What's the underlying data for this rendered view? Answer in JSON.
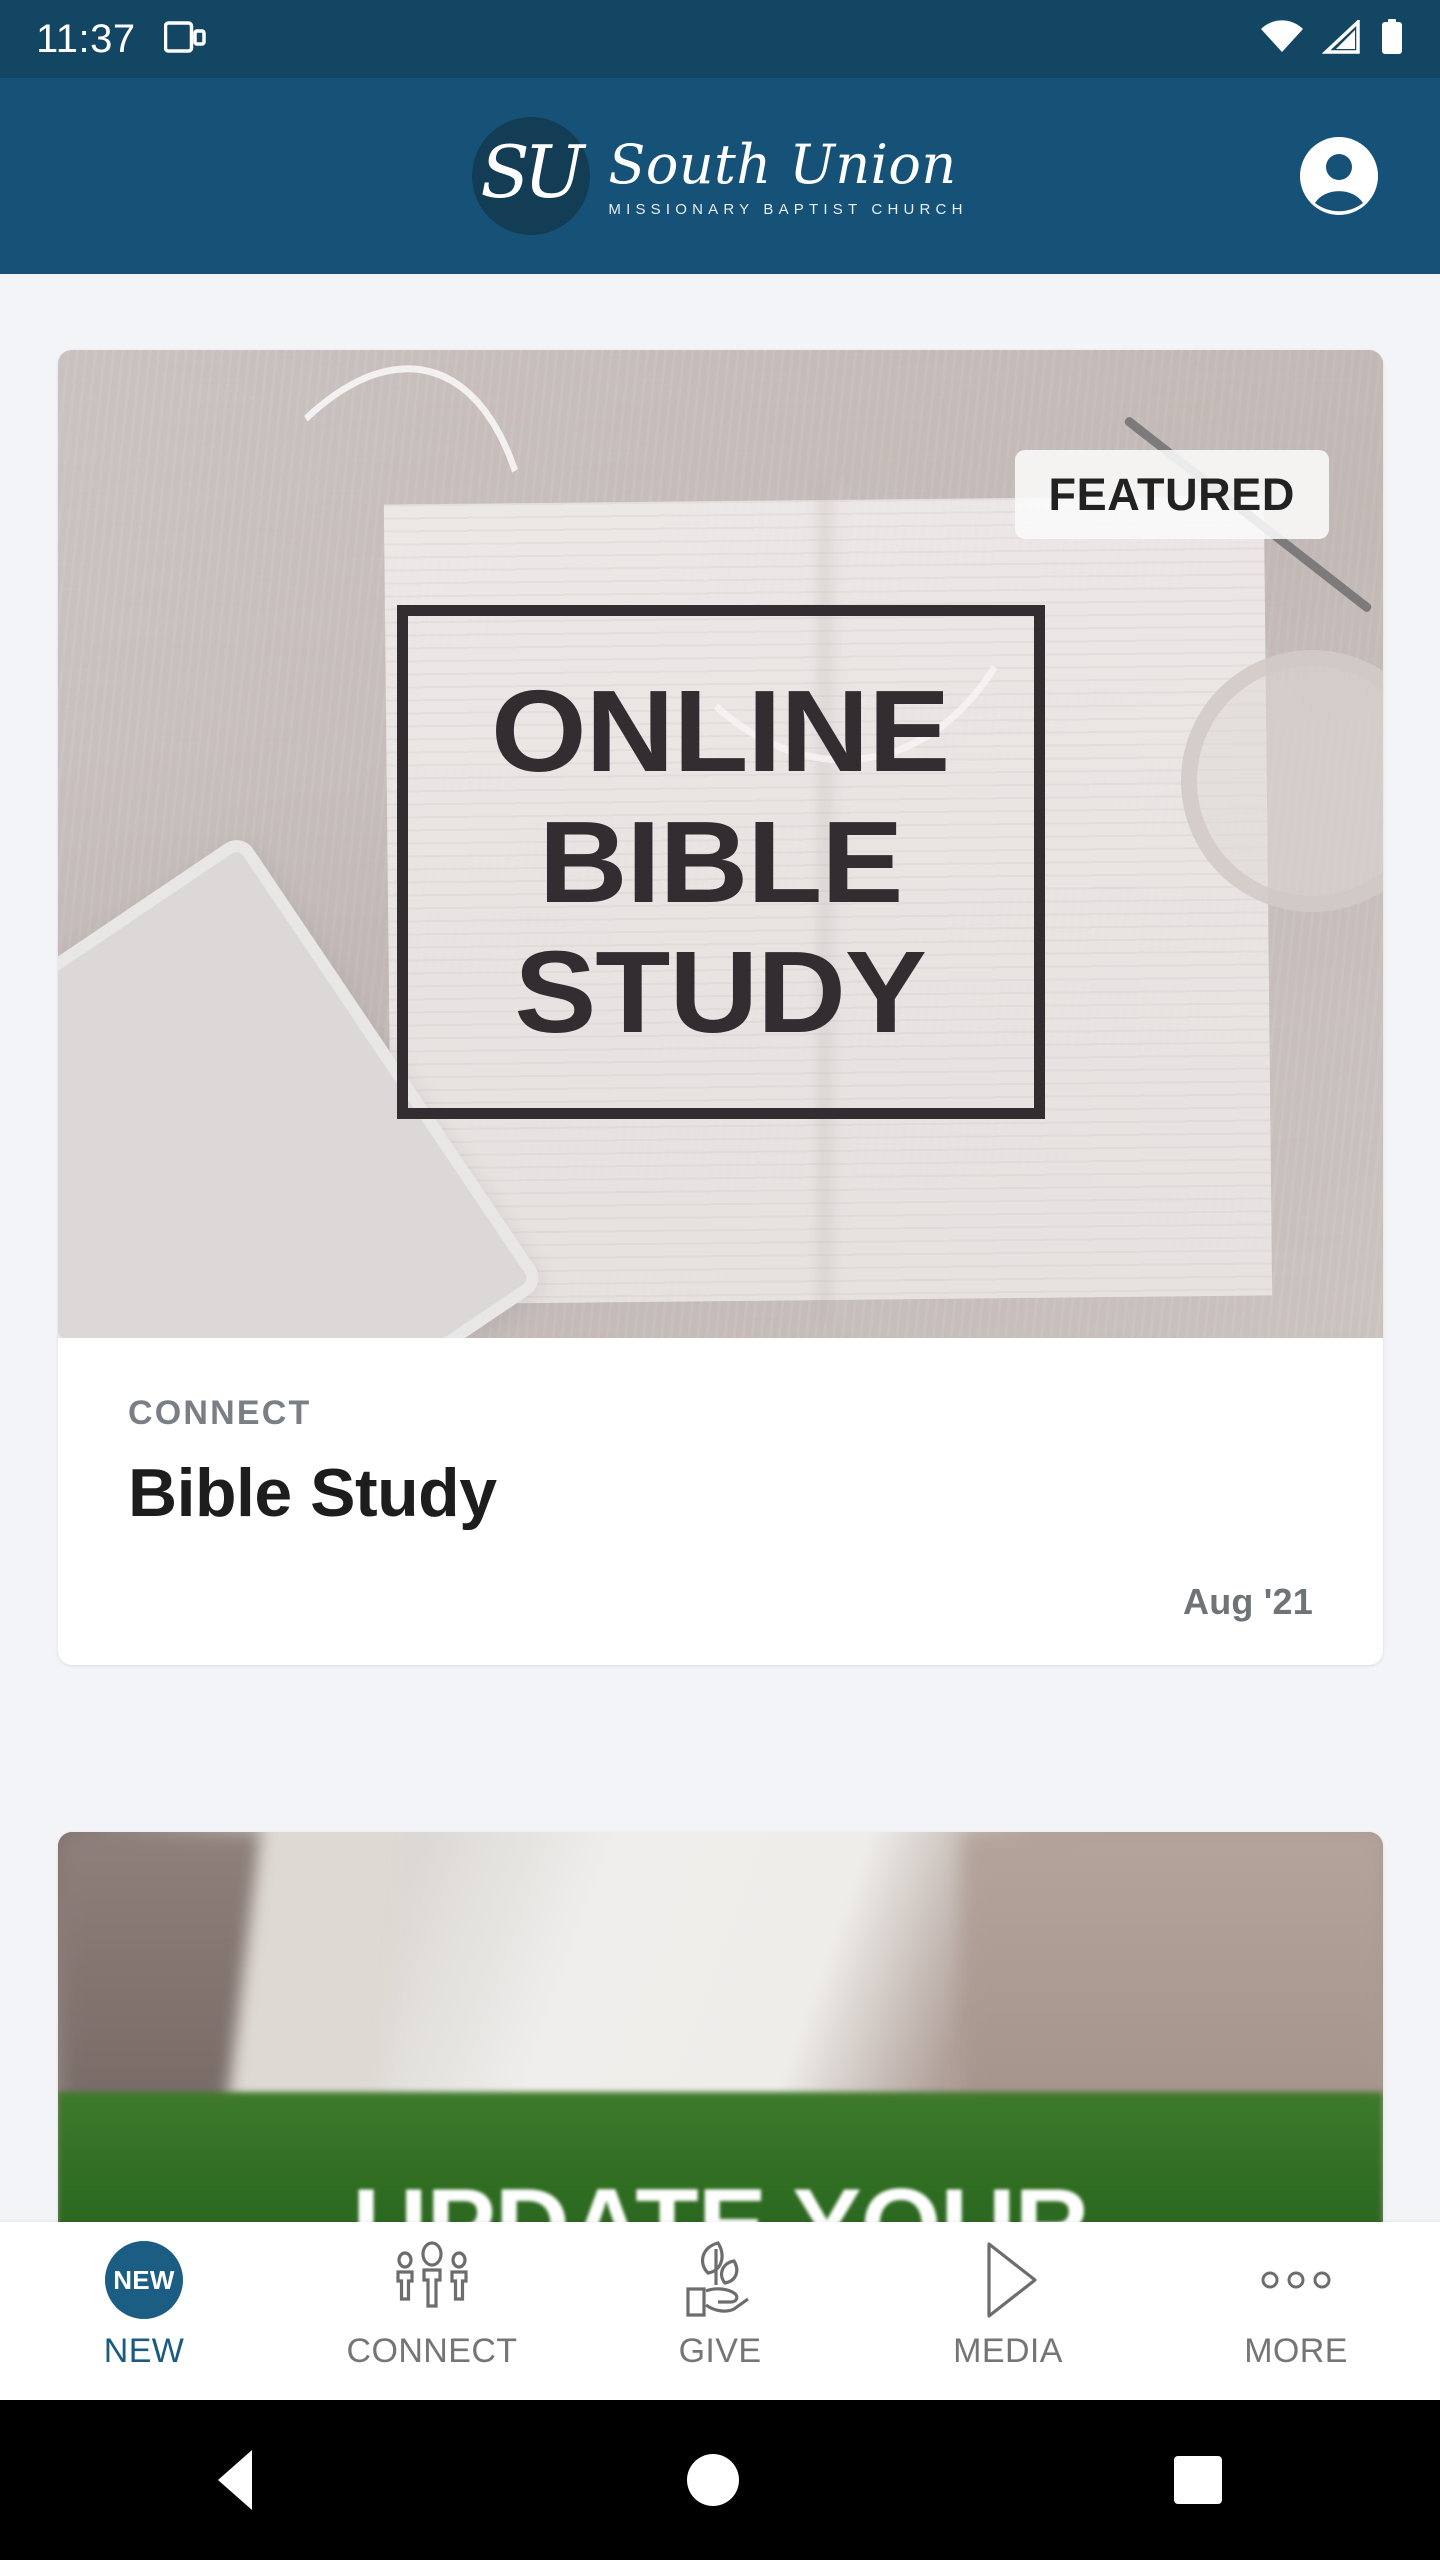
{
  "status_bar": {
    "time": "11:37",
    "icons": {
      "cast": "cast-icon",
      "wifi": "wifi-icon",
      "cellular": "cellular-signal-icon",
      "battery": "battery-full-icon"
    }
  },
  "header": {
    "logo_monogram": "SU",
    "logo_name": "South Union",
    "logo_tagline": "MISSIONARY BAPTIST CHURCH",
    "account_icon": "account-circle-icon",
    "background_color": "#165277"
  },
  "feed": {
    "cards": [
      {
        "badge": "FEATURED",
        "image_text_lines": [
          "ONLINE",
          "BIBLE",
          "STUDY"
        ],
        "eyebrow": "CONNECT",
        "title": "Bible Study",
        "date": "Aug '21"
      },
      {
        "image_text": "UPDATE YOUR"
      }
    ]
  },
  "tab_bar": {
    "active_index": 0,
    "tabs": [
      {
        "label": "NEW",
        "icon": "new-badge-icon",
        "badge_text": "NEW"
      },
      {
        "label": "CONNECT",
        "icon": "people-group-icon"
      },
      {
        "label": "GIVE",
        "icon": "hand-with-leaves-icon"
      },
      {
        "label": "MEDIA",
        "icon": "play-triangle-icon"
      },
      {
        "label": "MORE",
        "icon": "three-dots-icon"
      }
    ],
    "active_color": "#1A5B80",
    "inactive_color": "#757575"
  },
  "android_nav": {
    "back": "back-triangle-icon",
    "home": "home-circle-icon",
    "recents": "recents-square-icon"
  }
}
